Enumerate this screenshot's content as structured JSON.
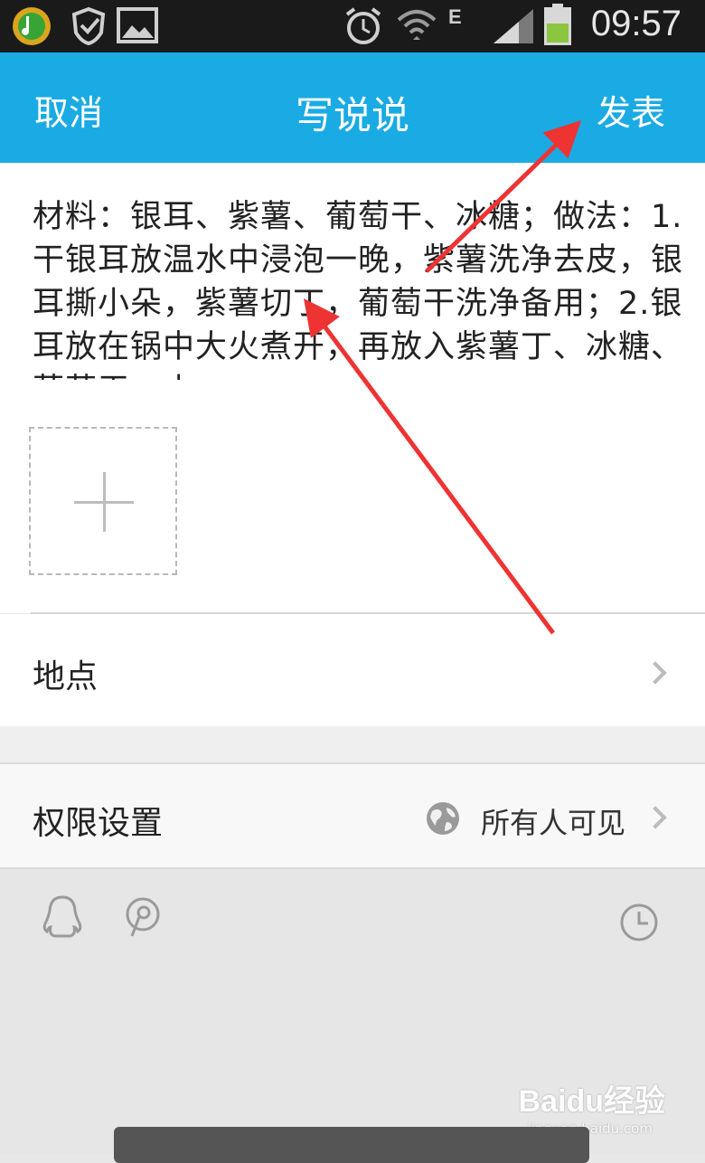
{
  "status_bar": {
    "time": "09:57",
    "network_type": "E",
    "icons": [
      "qq-music-icon",
      "security-shield-icon",
      "gallery-icon",
      "alarm-icon",
      "wifi-icon",
      "signal-icon",
      "battery-icon"
    ]
  },
  "nav": {
    "cancel_label": "取消",
    "title": "写说说",
    "publish_label": "发表"
  },
  "editor": {
    "content": "材料：银耳、紫薯、葡萄干、冰糖；做法：1.干银耳放温水中浸泡一晚，紫薯洗净去皮，银耳撕小朵，紫薯切丁，葡萄干洗净备用；2.银耳放在锅中大火煮开，再放入紫薯丁、冰糖、葡萄干，小"
  },
  "media": {
    "add_photo_icon": "plus-icon"
  },
  "location": {
    "label": "地点"
  },
  "permission": {
    "label": "权限设置",
    "value": "所有人可见"
  },
  "toolbar": {
    "icons": [
      "qq-penguin-icon",
      "mention-icon",
      "clock-icon"
    ]
  },
  "watermark": {
    "main": "Baidu经验",
    "sub": "jingyan.baidu.com"
  },
  "colors": {
    "nav_bg": "#1aaae4",
    "annotation_arrow": "#ee3333"
  }
}
